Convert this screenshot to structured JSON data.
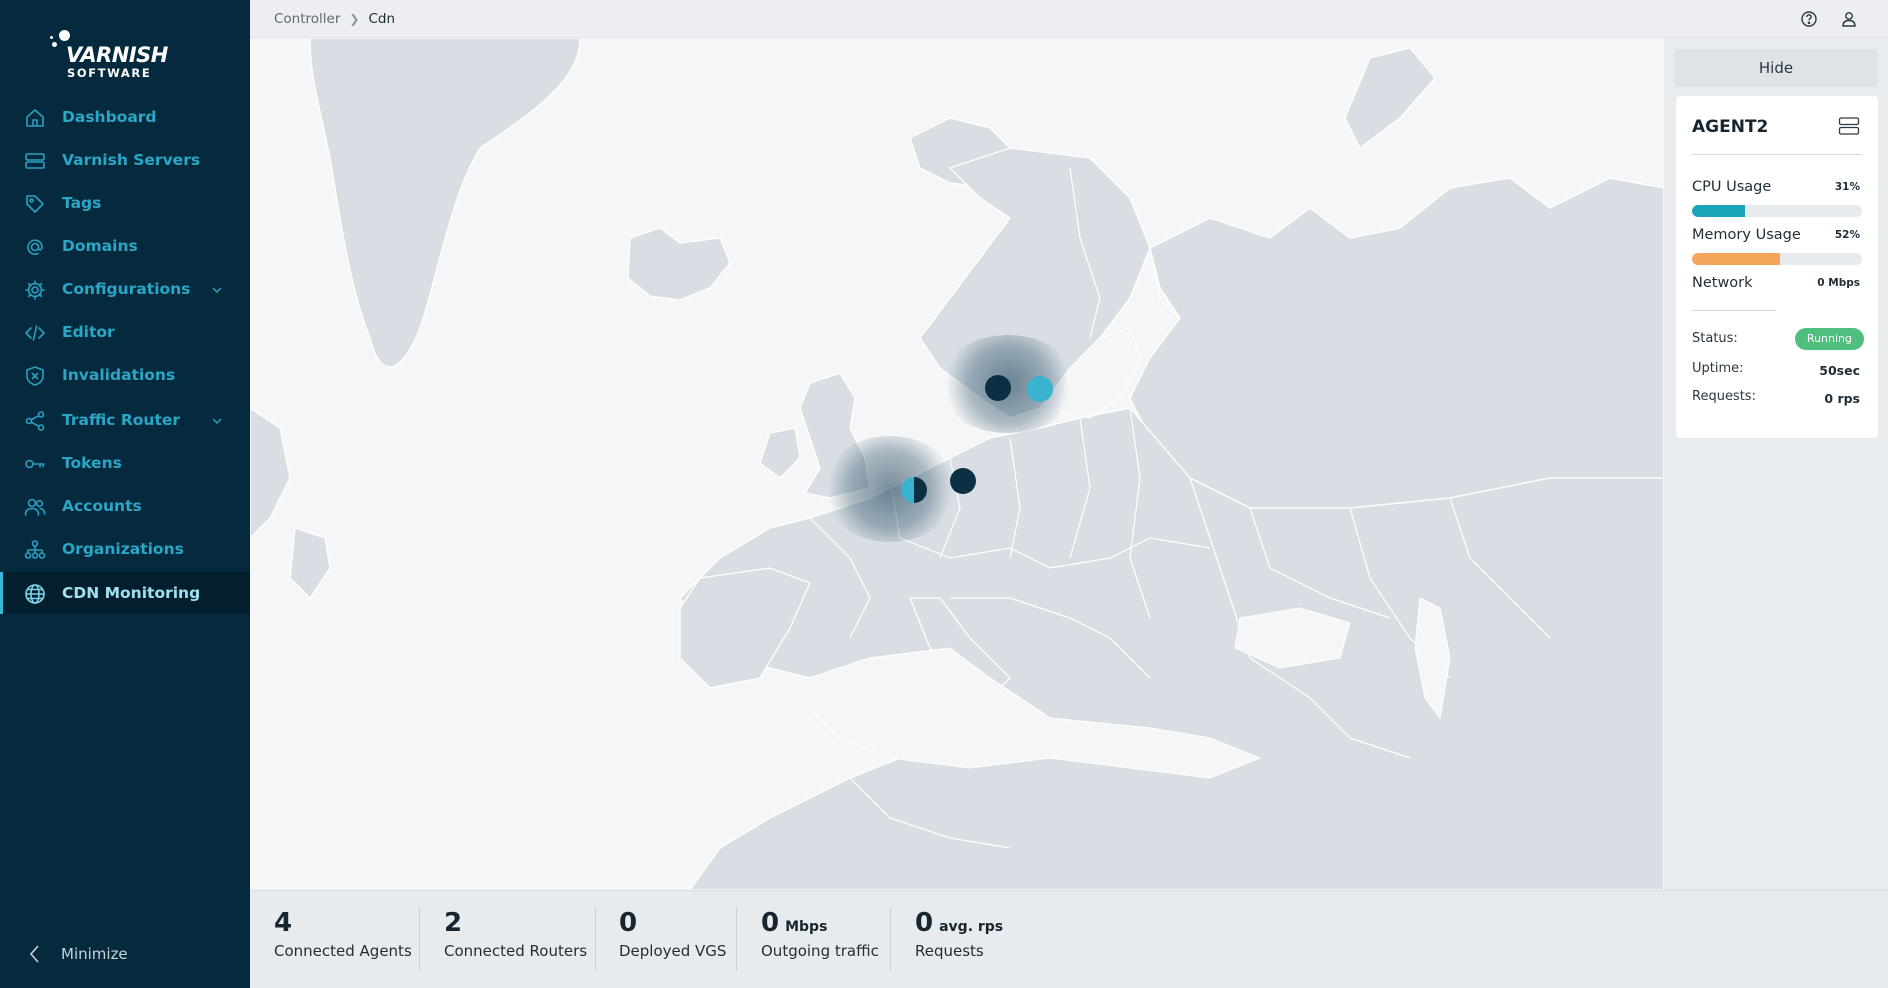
{
  "logo": {
    "brand": "VARNISH",
    "sub": "SOFTWARE"
  },
  "sidebar": {
    "items": [
      {
        "label": "Dashboard",
        "icon": "home-icon"
      },
      {
        "label": "Varnish Servers",
        "icon": "server-icon"
      },
      {
        "label": "Tags",
        "icon": "tag-icon"
      },
      {
        "label": "Domains",
        "icon": "at-icon"
      },
      {
        "label": "Configurations",
        "icon": "gear-icon",
        "expandable": true
      },
      {
        "label": "Editor",
        "icon": "code-icon"
      },
      {
        "label": "Invalidations",
        "icon": "shield-icon"
      },
      {
        "label": "Traffic Router",
        "icon": "share-icon",
        "expandable": true
      },
      {
        "label": "Tokens",
        "icon": "key-icon"
      },
      {
        "label": "Accounts",
        "icon": "users-icon"
      },
      {
        "label": "Organizations",
        "icon": "org-icon"
      },
      {
        "label": "CDN Monitoring",
        "icon": "globe-icon",
        "active": true
      }
    ],
    "minimize_label": "Minimize"
  },
  "breadcrumb": {
    "parent": "Controller",
    "current": "Cdn"
  },
  "right_panel": {
    "hide_label": "Hide",
    "agent": {
      "name": "AGENT2",
      "cpu_label": "CPU Usage",
      "cpu_value": "31%",
      "cpu_fraction": 0.31,
      "memory_label": "Memory Usage",
      "memory_value": "52%",
      "memory_fraction": 0.52,
      "network_label": "Network",
      "network_value": "0 Mbps",
      "status_label": "Status:",
      "status_value": "Running",
      "uptime_label": "Uptime:",
      "uptime_value": "50sec",
      "requests_label": "Requests:",
      "requests_value": "0 rps"
    }
  },
  "stats": [
    {
      "value": "4",
      "unit": "",
      "caption": "Connected Agents"
    },
    {
      "value": "2",
      "unit": "",
      "caption": "Connected Routers"
    },
    {
      "value": "0",
      "unit": "",
      "caption": "Deployed VGS"
    },
    {
      "value": "0",
      "unit": "Mbps",
      "caption": "Outgoing traffic"
    },
    {
      "value": "0",
      "unit": "avg. rps",
      "caption": "Requests"
    }
  ],
  "colors": {
    "sidebar_bg": "#052a3e",
    "accent": "#2aa6c6",
    "cpu_bar": "#1ba3b9",
    "memory_bar": "#f5a55a",
    "status_running": "#4fbe7f",
    "marker_dark": "#0c3043",
    "marker_light": "#3ab3cf"
  }
}
